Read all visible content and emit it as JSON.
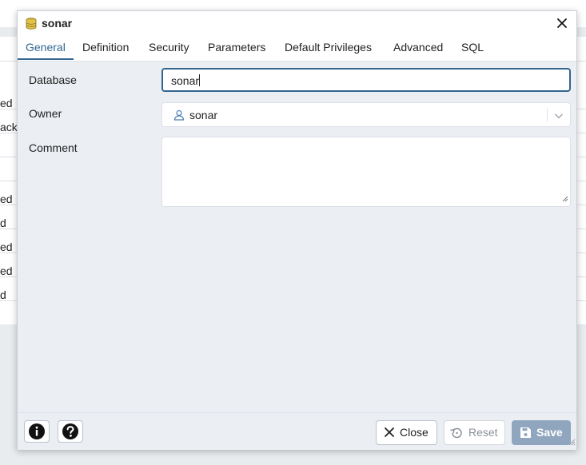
{
  "background": {
    "rows": [
      "ed",
      "ack",
      "",
      "",
      "ed",
      "d",
      "ed",
      "ed",
      "d"
    ]
  },
  "dialog": {
    "title": "sonar",
    "tabs": [
      {
        "label": "General",
        "active": true
      },
      {
        "label": "Definition",
        "active": false
      },
      {
        "label": "Security",
        "active": false
      },
      {
        "label": "Parameters",
        "active": false
      },
      {
        "label": "Default Privileges",
        "active": false
      },
      {
        "label": "Advanced",
        "active": false
      },
      {
        "label": "SQL",
        "active": false
      }
    ],
    "fields": {
      "database_label": "Database",
      "database_value": "sonar",
      "owner_label": "Owner",
      "owner_value": "sonar",
      "comment_label": "Comment",
      "comment_value": ""
    },
    "footer": {
      "close_label": "Close",
      "reset_label": "Reset",
      "save_label": "Save"
    }
  },
  "colors": {
    "accent": "#326690",
    "save_button": "#8fa6be",
    "dialog_bg": "#ebeef3"
  },
  "icons": {
    "title": "database-icon",
    "owner": "user-icon",
    "info": "info-icon",
    "help": "help-icon",
    "close": "close-icon",
    "reset": "reset-icon",
    "save": "save-icon"
  }
}
